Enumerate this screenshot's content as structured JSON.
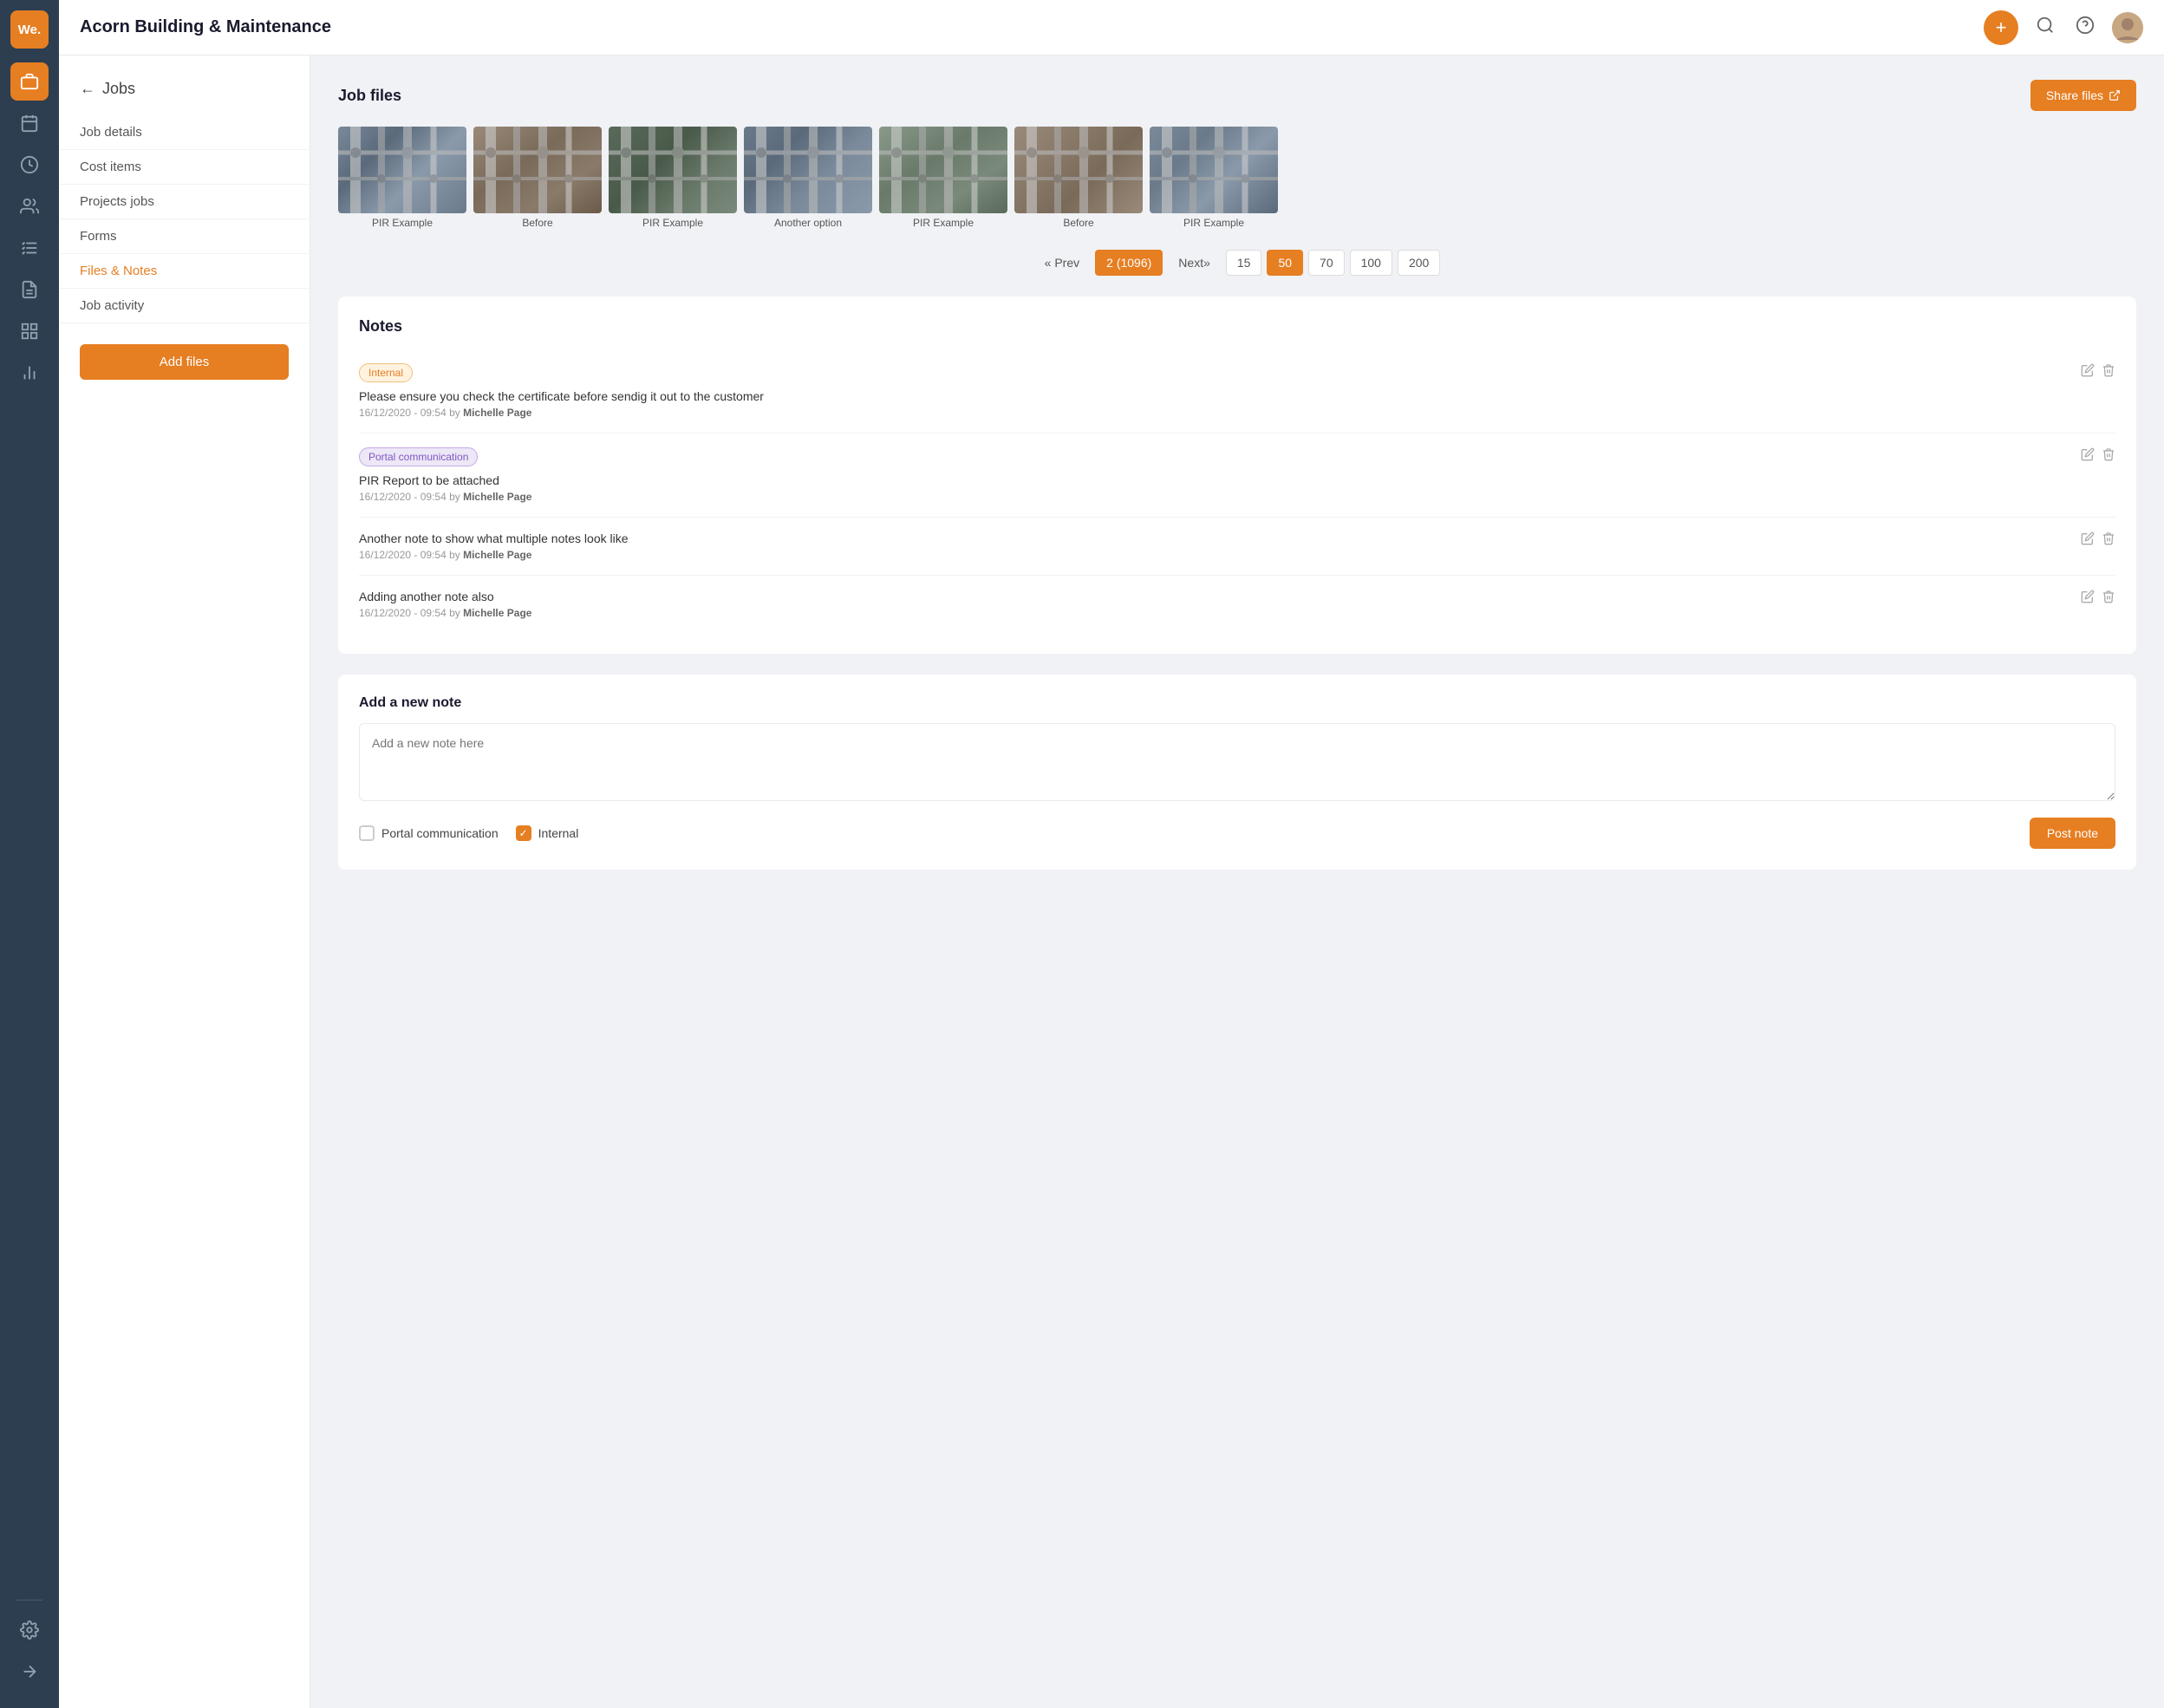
{
  "app": {
    "logo_text": "We.",
    "company_name": "Acorn Building & Maintenance"
  },
  "rail": {
    "icons": [
      {
        "name": "briefcase-icon",
        "symbol": "💼",
        "active": true
      },
      {
        "name": "calendar-icon",
        "symbol": "📅",
        "active": false
      },
      {
        "name": "clock-icon",
        "symbol": "🕐",
        "active": false
      },
      {
        "name": "people-icon",
        "symbol": "👥",
        "active": false
      },
      {
        "name": "list-icon",
        "symbol": "📋",
        "active": false
      },
      {
        "name": "document-icon",
        "symbol": "📄",
        "active": false
      },
      {
        "name": "grid-icon",
        "symbol": "⊞",
        "active": false
      },
      {
        "name": "chart-icon",
        "symbol": "📊",
        "active": false
      }
    ],
    "bottom_icons": [
      {
        "name": "arrow-right-icon",
        "symbol": "→"
      },
      {
        "name": "settings-icon",
        "symbol": "⚙"
      }
    ]
  },
  "header": {
    "title": "Acorn Building & Maintenance",
    "add_button_label": "+",
    "search_label": "🔍",
    "help_label": "?"
  },
  "sidebar": {
    "back_label": "Jobs",
    "nav_items": [
      {
        "id": "job-details",
        "label": "Job details",
        "active": false
      },
      {
        "id": "cost-items",
        "label": "Cost items",
        "active": false
      },
      {
        "id": "projects-jobs",
        "label": "Projects jobs",
        "active": false
      },
      {
        "id": "forms",
        "label": "Forms",
        "active": false
      },
      {
        "id": "files-notes",
        "label": "Files & Notes",
        "active": true
      },
      {
        "id": "job-activity",
        "label": "Job activity",
        "active": false
      }
    ],
    "add_button_label": "Add files"
  },
  "job_files": {
    "section_title": "Job files",
    "share_button_label": "Share files",
    "images": [
      {
        "label": "PIR Example",
        "bg_class": "pipe-bg1"
      },
      {
        "label": "Before",
        "bg_class": "pipe-bg2"
      },
      {
        "label": "PIR Example",
        "bg_class": "pipe-bg3"
      },
      {
        "label": "Another option",
        "bg_class": "pipe-bg1"
      },
      {
        "label": "PIR Example",
        "bg_class": "pipe-bg2"
      },
      {
        "label": "Before",
        "bg_class": "pipe-bg3"
      },
      {
        "label": "PIR Example",
        "bg_class": "pipe-bg1"
      }
    ],
    "pagination": {
      "prev_label": "« Prev",
      "current_page": "2 (1096)",
      "next_label": "Next»",
      "page_sizes": [
        "15",
        "50",
        "70",
        "100",
        "200"
      ],
      "active_size": "50"
    }
  },
  "notes": {
    "section_title": "Notes",
    "items": [
      {
        "badge": "Internal",
        "badge_type": "internal",
        "text": "Please ensure you check the certificate before sendig it out to the customer",
        "date": "16/12/2020 - 09:54 by",
        "author": "Michelle Page"
      },
      {
        "badge": "Portal communication",
        "badge_type": "portal",
        "text": "PIR Report to be attached",
        "date": "16/12/2020 - 09:54 by",
        "author": "Michelle Page"
      },
      {
        "badge": "",
        "badge_type": "",
        "text": "Another note to show what multiple notes look like",
        "date": "16/12/2020 - 09:54 by",
        "author": "Michelle Page"
      },
      {
        "badge": "",
        "badge_type": "",
        "text": "Adding another note also",
        "date": "16/12/2020 - 09:54 by",
        "author": "Michelle Page"
      }
    ]
  },
  "add_note": {
    "section_title": "Add a new note",
    "placeholder": "Add a new note here",
    "portal_label": "Portal communication",
    "internal_label": "Internal",
    "post_button_label": "Post note"
  }
}
